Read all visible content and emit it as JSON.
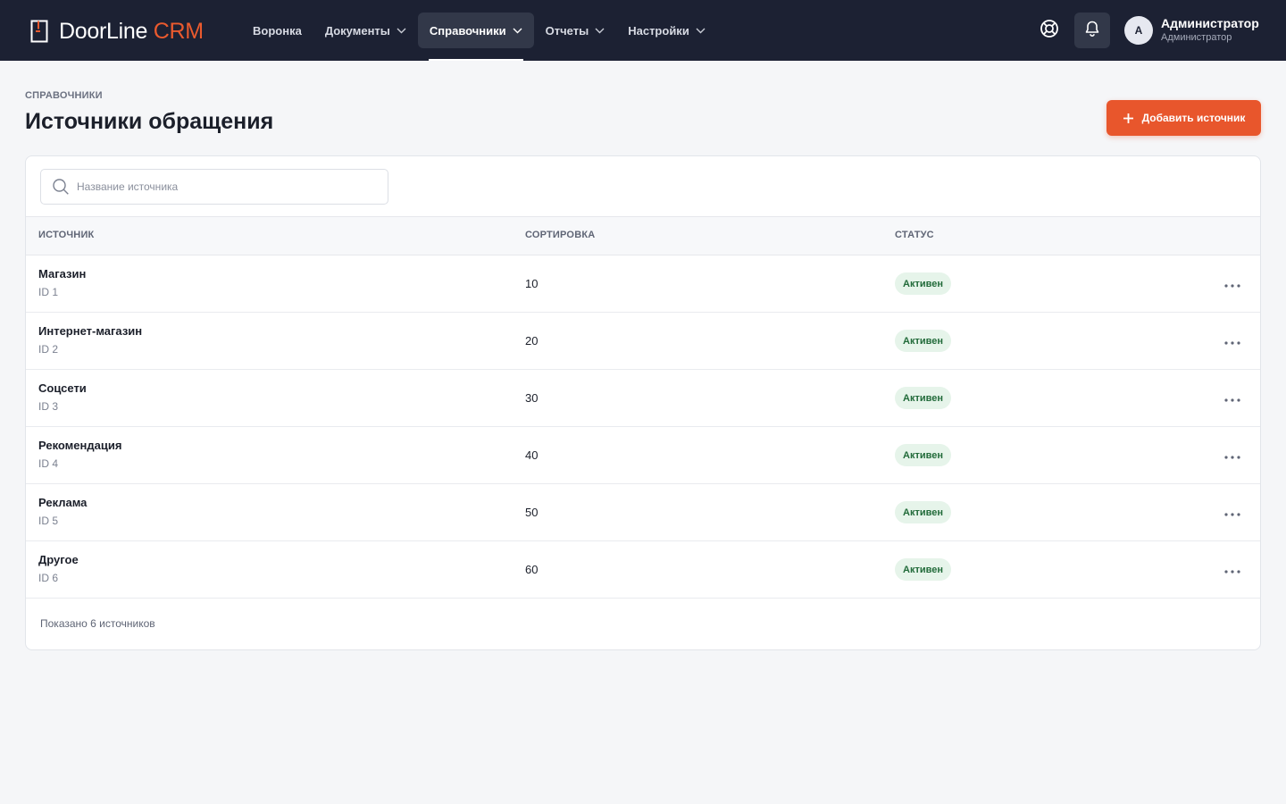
{
  "app": {
    "logo_main": "DoorLine",
    "logo_accent": "CRM"
  },
  "nav": {
    "items": [
      {
        "label": "Воронка",
        "dropdown": false
      },
      {
        "label": "Документы",
        "dropdown": true
      },
      {
        "label": "Справочники",
        "dropdown": true,
        "active": true
      },
      {
        "label": "Отчеты",
        "dropdown": true
      },
      {
        "label": "Настройки",
        "dropdown": true
      }
    ]
  },
  "user": {
    "initial": "А",
    "name": "Администратор",
    "role": "Администратор"
  },
  "page": {
    "breadcrumb": "СПРАВОЧНИКИ",
    "title": "Источники обращения",
    "add_button": "Добавить источник"
  },
  "search": {
    "placeholder": "Название источника",
    "value": ""
  },
  "table": {
    "columns": {
      "source": "ИСТОЧНИК",
      "sort": "СОРТИРОВКА",
      "status": "СТАТУС"
    },
    "rows": [
      {
        "name": "Магазин",
        "id": "ID 1",
        "sort": "10",
        "status": "Активен"
      },
      {
        "name": "Интернет-магазин",
        "id": "ID 2",
        "sort": "20",
        "status": "Активен"
      },
      {
        "name": "Соцсети",
        "id": "ID 3",
        "sort": "30",
        "status": "Активен"
      },
      {
        "name": "Рекомендация",
        "id": "ID 4",
        "sort": "40",
        "status": "Активен"
      },
      {
        "name": "Реклама",
        "id": "ID 5",
        "sort": "50",
        "status": "Активен"
      },
      {
        "name": "Другое",
        "id": "ID 6",
        "sort": "60",
        "status": "Активен"
      }
    ],
    "footer": "Показано 6 источников"
  },
  "colors": {
    "header_bg": "#1c2133",
    "accent": "#e8562c",
    "active_badge_bg": "#e6f4ea",
    "active_badge_text": "#226b3a"
  },
  "icons": {
    "logo": "door-icon",
    "help": "lifebuoy-icon",
    "notifications": "bell-icon",
    "search": "search-icon",
    "row_menu": "more-horizontal-icon",
    "add": "plus-icon"
  }
}
